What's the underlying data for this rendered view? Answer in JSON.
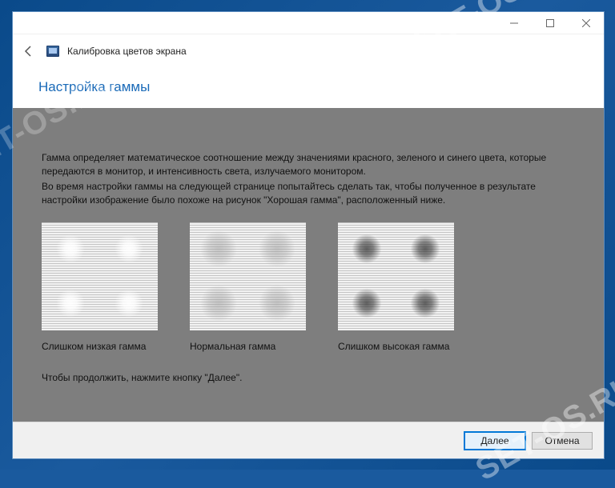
{
  "window": {
    "app_title": "Калибровка цветов экрана",
    "heading": "Настройка гаммы"
  },
  "content": {
    "p1": "Гамма определяет математическое соотношение между значениями красного, зеленого и синего цвета, которые передаются в монитор, и интенсивность света, излучаемого монитором.",
    "p2": "Во время настройки гаммы на следующей странице попытайтесь сделать так, чтобы полученное в результате настройки изображение было похоже на рисунок \"Хорошая гамма\", расположенный ниже.",
    "continue": "Чтобы продолжить, нажмите кнопку \"Далее\"."
  },
  "samples": {
    "low": "Слишком низкая гамма",
    "normal": "Нормальная гамма",
    "high": "Слишком высокая гамма"
  },
  "footer": {
    "next": "Далее",
    "cancel": "Отмена"
  },
  "watermark": "SET-OS.RU"
}
